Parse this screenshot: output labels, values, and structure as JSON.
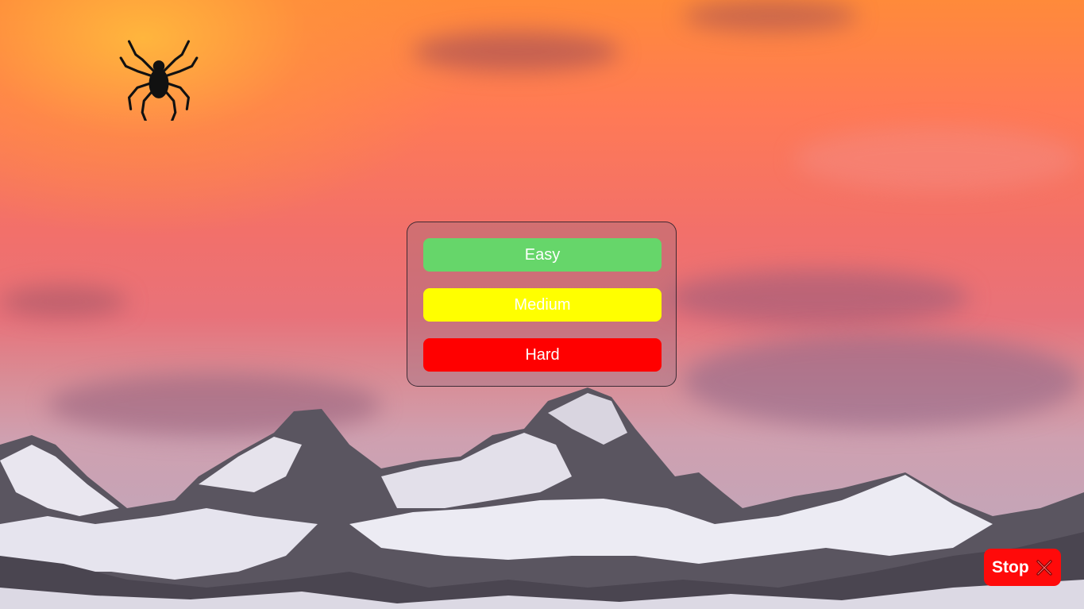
{
  "difficulty_menu": {
    "easy_label": "Easy",
    "medium_label": "Medium",
    "hard_label": "Hard"
  },
  "stop_button": {
    "label": "Stop",
    "icon": "close-icon"
  },
  "icons": {
    "spider": "spider-icon"
  },
  "colors": {
    "easy": "#66d66a",
    "medium": "#ffff00",
    "hard": "#ff0000",
    "stop": "#ff0a0a"
  }
}
